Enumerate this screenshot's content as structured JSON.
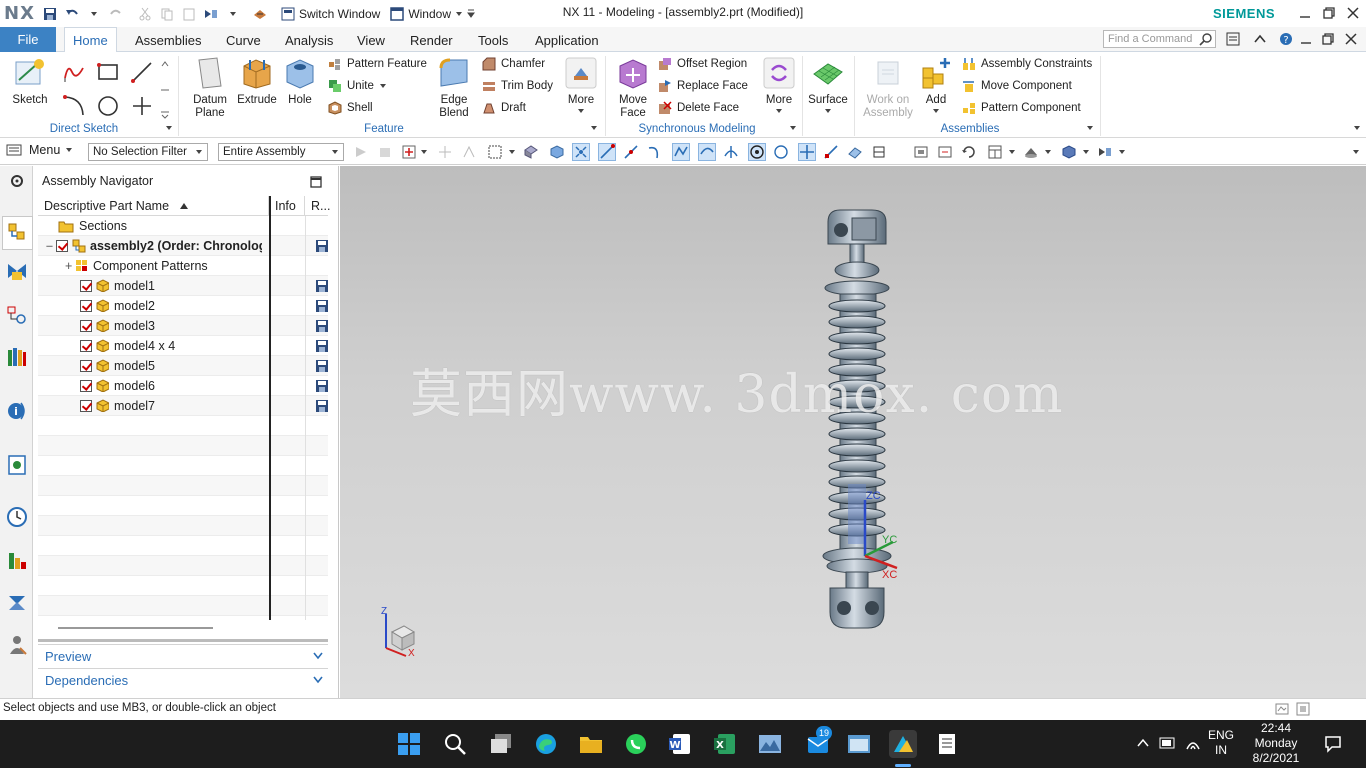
{
  "app": {
    "logo": "NX",
    "title": "NX 11 - Modeling - [assembly2.prt (Modified)]",
    "brand": "SIEMENS",
    "switch_window": "Switch Window",
    "window_menu": "Window"
  },
  "tabs": {
    "file": "File",
    "items": [
      "Home",
      "Assemblies",
      "Curve",
      "Analysis",
      "View",
      "Render",
      "Tools",
      "Application"
    ],
    "active": "Home"
  },
  "search": {
    "placeholder": "Find a Command"
  },
  "ribbon": {
    "sketch": "Sketch",
    "direct_sketch_group": "Direct Sketch",
    "datum_plane": "Datum\nPlane",
    "extrude": "Extrude",
    "hole": "Hole",
    "pattern_feature": "Pattern Feature",
    "unite": "Unite",
    "shell": "Shell",
    "edge_blend": "Edge\nBlend",
    "chamfer": "Chamfer",
    "trim_body": "Trim Body",
    "draft": "Draft",
    "more1": "More",
    "feature_group": "Feature",
    "move_face": "Move\nFace",
    "offset_region": "Offset Region",
    "replace_face": "Replace Face",
    "delete_face": "Delete Face",
    "more2": "More",
    "sync_group": "Synchronous Modeling",
    "surface": "Surface",
    "work_on_assembly": "Work on\nAssembly",
    "add": "Add",
    "assembly_constraints": "Assembly Constraints",
    "move_component": "Move Component",
    "pattern_component": "Pattern Component",
    "assemblies_group": "Assemblies"
  },
  "toolbar2": {
    "menu": "Menu",
    "selection_filter": "No Selection Filter",
    "scope": "Entire Assembly"
  },
  "navigator": {
    "title": "Assembly Navigator",
    "columns": [
      "Descriptive Part Name",
      "Info",
      "R..."
    ],
    "sections_label": "Sections",
    "root": "assembly2 (Order: Chronologi...",
    "component_patterns": "Component Patterns",
    "parts": [
      "model1",
      "model2",
      "model3",
      "model4 x 4",
      "model5",
      "model6",
      "model7"
    ],
    "preview": "Preview",
    "dependencies": "Dependencies"
  },
  "viewport": {
    "watermark": "莫西网www. 3dmox. com",
    "axis_zc": "ZC",
    "axis_yc": "YC",
    "axis_xc": "XC",
    "triad_z": "Z",
    "triad_x": "X"
  },
  "status": {
    "message": "Select objects and use MB3, or double-click an object"
  },
  "taskbar": {
    "lang1": "ENG",
    "lang2": "IN",
    "time": "22:44",
    "day": "Monday",
    "date": "8/2/2021",
    "badge": "19"
  },
  "colors": {
    "accent": "#2a6db5",
    "file_tab": "#3c82c4",
    "brand": "#009999",
    "taskbar": "#1d1d1d"
  }
}
